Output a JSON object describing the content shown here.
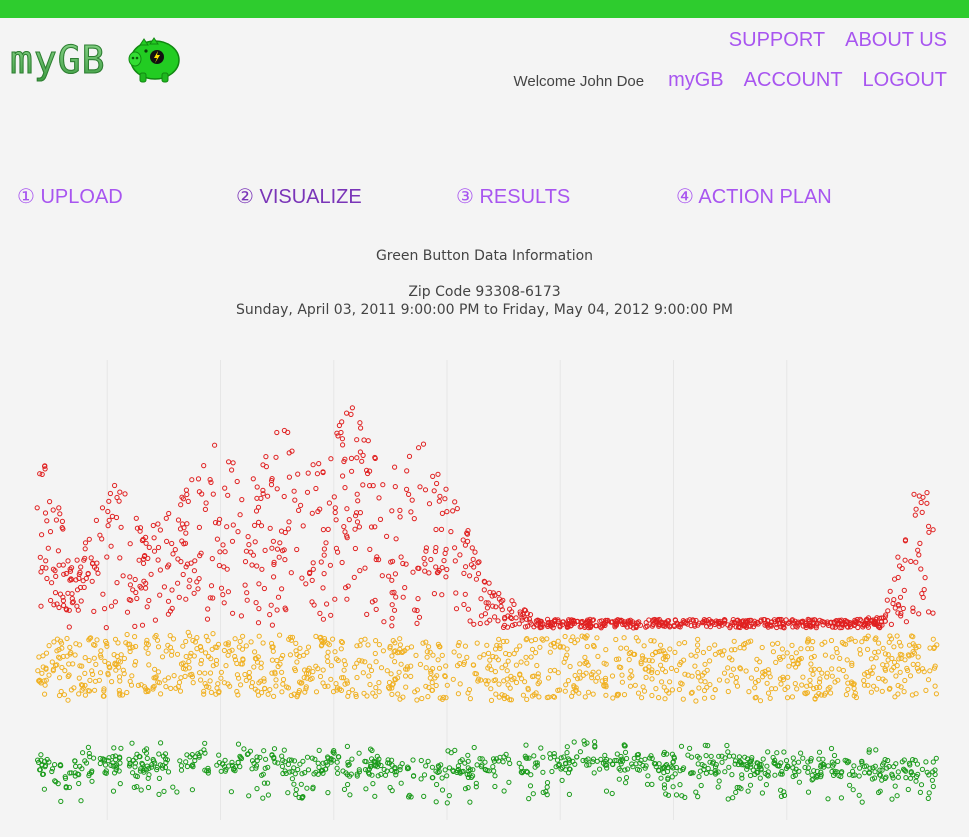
{
  "header": {
    "logo_text": "myGB",
    "nav_top": [
      "SUPPORT",
      "ABOUT US"
    ],
    "welcome": "Welcome John Doe",
    "nav_second": [
      "myGB",
      "ACCOUNT",
      "LOGOUT"
    ]
  },
  "steps": [
    {
      "label": "① UPLOAD"
    },
    {
      "label": "② VISUALIZE"
    },
    {
      "label": "③ RESULTS"
    },
    {
      "label": "④ ACTION PLAN"
    }
  ],
  "info": {
    "title": "Green Button Data Information",
    "zip": "Zip Code 93308-6173",
    "range": "Sunday, April 03, 2011 9:00:00 PM to Friday, May 04, 2012 9:00:00 PM"
  },
  "colors": {
    "accent": "#a855f0",
    "top_bar": "#2ecc2e",
    "high": "#e02020",
    "medium": "#f0b020",
    "low": "#1a9a1a"
  },
  "chart_data": {
    "type": "scatter",
    "title": "",
    "xlabel": "",
    "ylabel": "",
    "x_range": [
      "2011-04-03",
      "2012-05-04"
    ],
    "grid": true,
    "series": [
      {
        "color": "#e02020",
        "note_level": "high",
        "points": [
          [
            "2011-04-05",
            0.82
          ],
          [
            "2011-04-20",
            0.55
          ],
          [
            "2011-05-10",
            0.78
          ],
          [
            "2011-05-20",
            0.62
          ],
          [
            "2011-06-05",
            0.7
          ],
          [
            "2011-06-20",
            0.85
          ],
          [
            "2011-07-05",
            0.74
          ],
          [
            "2011-07-20",
            0.88
          ],
          [
            "2011-08-05",
            0.8
          ],
          [
            "2011-08-20",
            0.92
          ],
          [
            "2011-09-05",
            0.76
          ],
          [
            "2011-09-20",
            0.84
          ],
          [
            "2011-10-05",
            0.7
          ],
          [
            "2011-10-20",
            0.5
          ],
          [
            "2011-11-10",
            0.42
          ],
          [
            "2011-12-05",
            0.4
          ],
          [
            "2012-01-10",
            0.41
          ],
          [
            "2012-02-10",
            0.42
          ],
          [
            "2012-03-10",
            0.4
          ],
          [
            "2012-04-10",
            0.43
          ],
          [
            "2012-04-28",
            0.8
          ]
        ]
      },
      {
        "color": "#f0b020",
        "note_level": "medium",
        "points": [
          [
            "2011-04-05",
            0.3
          ],
          [
            "2011-06-01",
            0.32
          ],
          [
            "2011-08-01",
            0.31
          ],
          [
            "2011-10-01",
            0.3
          ],
          [
            "2011-12-01",
            0.31
          ],
          [
            "2012-02-01",
            0.3
          ],
          [
            "2012-04-01",
            0.31
          ]
        ]
      },
      {
        "color": "#1a9a1a",
        "note_level": "low",
        "points": [
          [
            "2011-04-05",
            0.08
          ],
          [
            "2011-06-01",
            0.1
          ],
          [
            "2011-08-01",
            0.09
          ],
          [
            "2011-10-01",
            0.08
          ],
          [
            "2011-12-01",
            0.1
          ],
          [
            "2012-02-01",
            0.09
          ],
          [
            "2012-04-01",
            0.08
          ]
        ]
      }
    ]
  }
}
